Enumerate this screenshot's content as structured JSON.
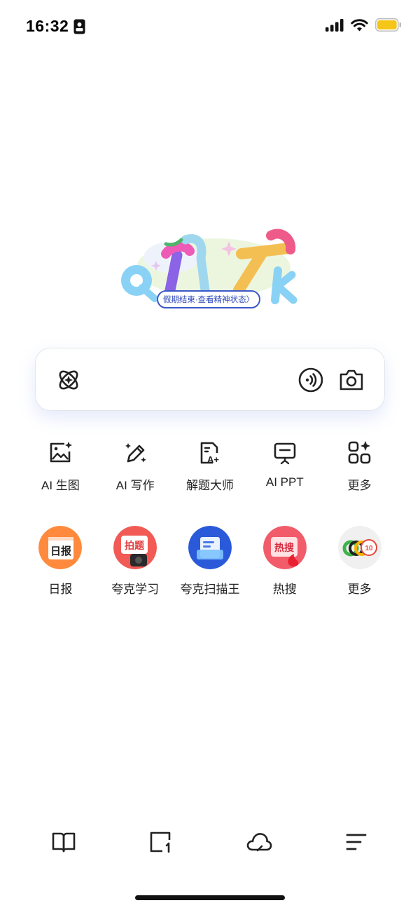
{
  "status_bar": {
    "time": "16:32",
    "icons": [
      "id-card-icon",
      "signal-icon",
      "wifi-icon",
      "battery-icon"
    ],
    "battery_color": "#f5c518"
  },
  "doodle": {
    "logo_letters": "QUARK",
    "banner_text": "假期结束·查看精神状态〉"
  },
  "search": {
    "icons": [
      "ai-atom-icon",
      "voice-icon",
      "camera-icon"
    ]
  },
  "tools": [
    {
      "label": "AI 生图",
      "icon": "image-sparkle-icon"
    },
    {
      "label": "AI 写作",
      "icon": "pen-sparkle-icon"
    },
    {
      "label": "解题大师",
      "icon": "doc-a-plus-icon"
    },
    {
      "label": "AI PPT",
      "icon": "presentation-icon"
    },
    {
      "label": "更多",
      "icon": "grid-sparkle-icon"
    }
  ],
  "apps": [
    {
      "label": "日报",
      "icon": "daily-report-icon",
      "badge_text": "日报"
    },
    {
      "label": "夸克学习",
      "icon": "quark-learn-icon",
      "badge_text": "拍题"
    },
    {
      "label": "夸克扫描王",
      "icon": "scanner-icon"
    },
    {
      "label": "热搜",
      "icon": "hot-search-icon",
      "badge_text": "热搜"
    },
    {
      "label": "更多",
      "icon": "more-apps-icon",
      "badge_text": "10"
    }
  ],
  "bottom_nav": {
    "items": [
      "book-icon",
      "tabs-icon",
      "cloud-icon",
      "menu-icon"
    ]
  },
  "colors": {
    "accent_blue": "#2d48b8",
    "text": "#222222"
  }
}
